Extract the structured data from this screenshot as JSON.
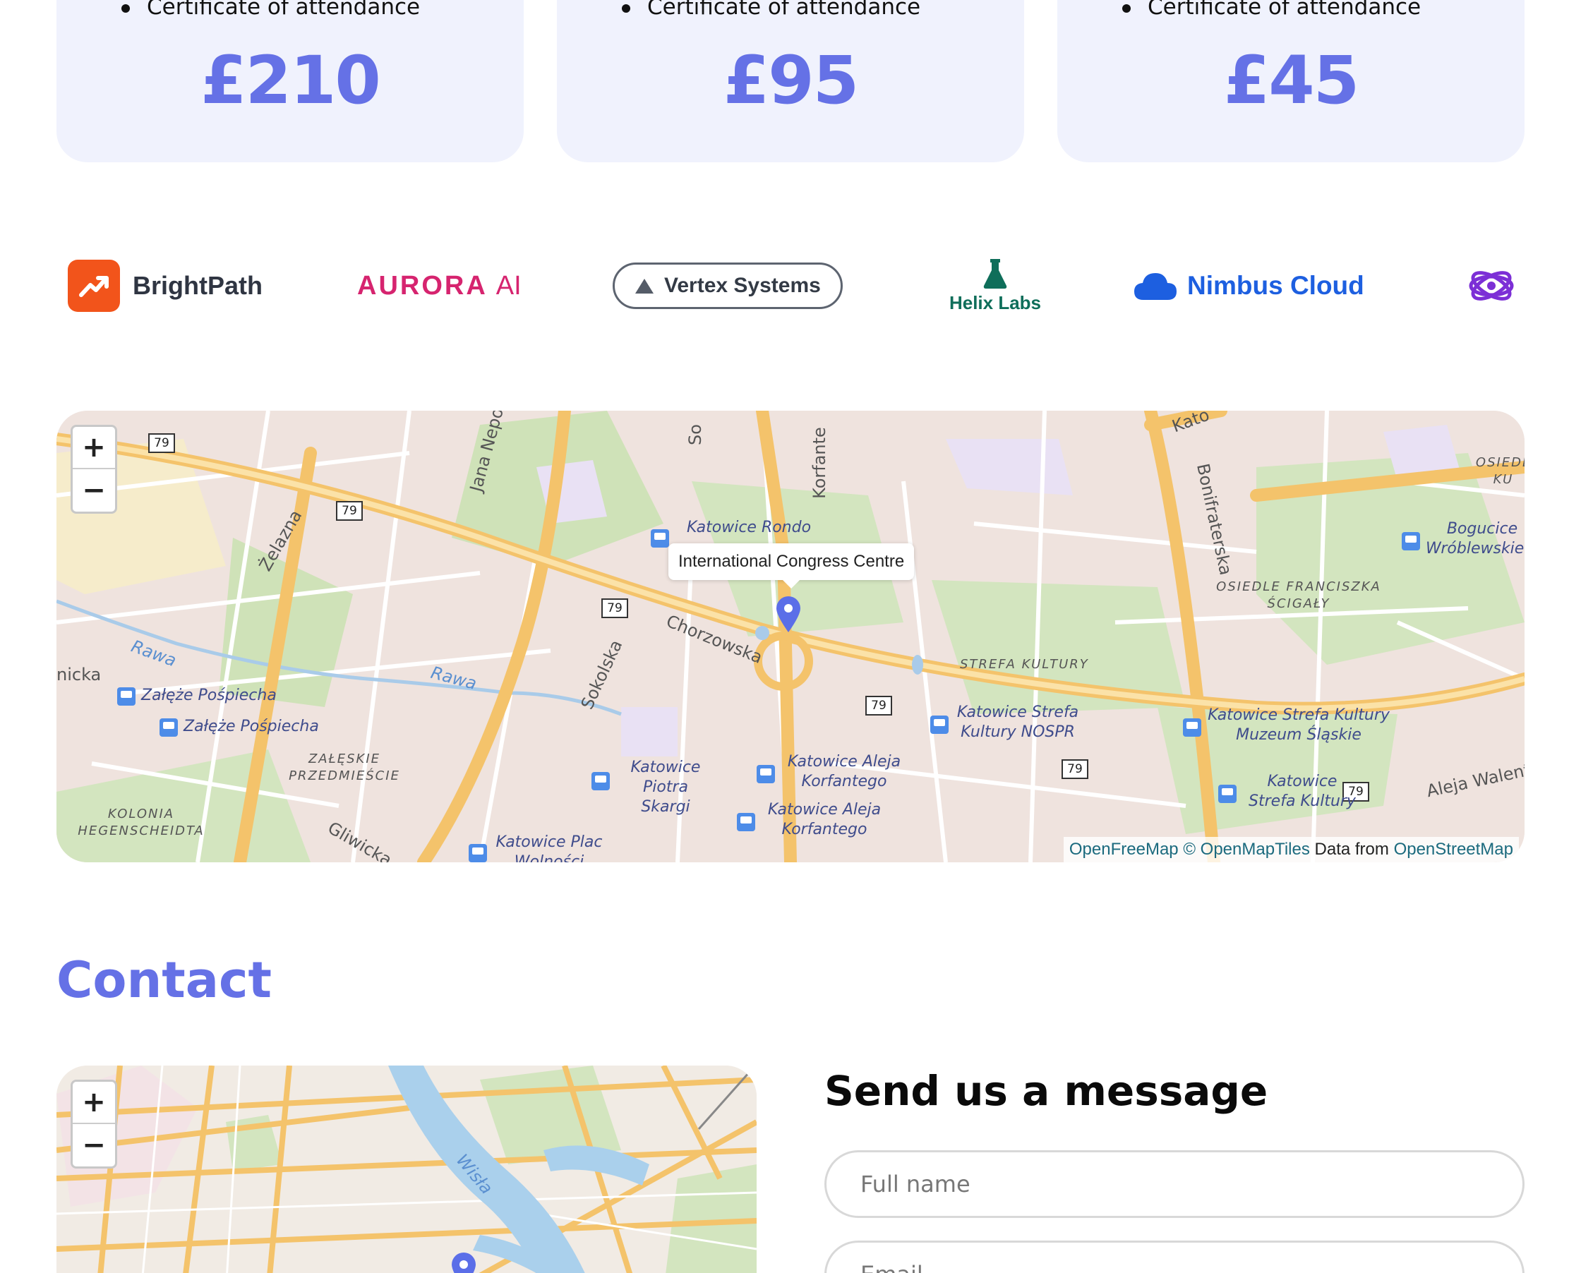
{
  "pricing": {
    "cards": [
      {
        "bullet": "Certificate of attendance",
        "price": "£210"
      },
      {
        "bullet": "Certificate of attendance",
        "price": "£95"
      },
      {
        "bullet": "Certificate of attendance",
        "price": "£45"
      }
    ]
  },
  "sponsors": {
    "brightpath": "BrightPath",
    "aurora_main": "AURORA",
    "aurora_suffix": "AI",
    "vertex": "Vertex Systems",
    "helix": "Helix Labs",
    "nimbus": "Nimbus Cloud"
  },
  "venue_map": {
    "zoom_in": "+",
    "zoom_out": "−",
    "popup": "International Congress Centre",
    "attribution": {
      "openfreemap": "OpenFreeMap",
      "openmaptiles": "© OpenMapTiles",
      "data_from": "Data from",
      "osm": "OpenStreetMap"
    },
    "street_labels": [
      "Jana Nepom",
      "So",
      "Korfante",
      "Żelazna",
      "Rawa",
      "Rawa",
      "Chorzowska",
      "Sokolska",
      "Gliwicka",
      "Bonifraterska",
      "Aleja Walent",
      "Kato",
      "nicka"
    ],
    "stop_labels": [
      "Katowice Rondo",
      "Załęże Pośpiecha",
      "Załęże Pośpiecha",
      "Katowice Piotra Skargi",
      "Katowice Aleja Korfantego",
      "Katowice Aleja Korfantego",
      "Katowice Strefa Kultury NOSPR",
      "Katowice Strefa Kultury Muzeum Śląskie",
      "Katowice Strefa Kultury",
      "Katowice Plac Wolności",
      "Bogucice Wróblewskiego"
    ],
    "district_labels": [
      "ZAŁĘSKIE PRZEDMIEŚCIE",
      "KOLONIA HEGENSCHEIDTA",
      "OSIEDLE FRANCISZKA ŚCIGAŁY",
      "STREFA KULTURY",
      "OSIEDL KU"
    ],
    "road_number": "79"
  },
  "contact": {
    "title": "Contact",
    "map_zoom_in": "+",
    "map_zoom_out": "−",
    "river_label": "Wisła",
    "form_title": "Send us a message",
    "name_placeholder": "Full name",
    "email_placeholder": "Email"
  },
  "colors": {
    "accent": "#6571e6",
    "card_bg": "#f0f2fd",
    "brightpath": "#f2541b",
    "aurora": "#d6246f",
    "helix": "#0f6e5a",
    "nimbus": "#1d5fe0",
    "atom": "#7c2fd6"
  }
}
